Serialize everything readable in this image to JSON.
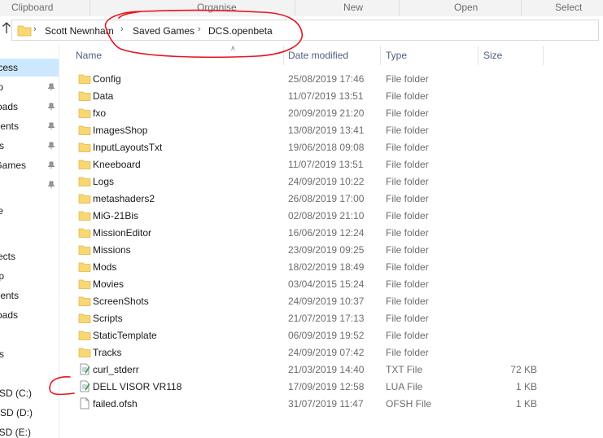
{
  "ribbon": {
    "groups": [
      "Clipboard",
      "Organise",
      "New",
      "Open",
      "Select"
    ]
  },
  "address": {
    "crumbs": [
      "Scott Newnham",
      "Saved Games",
      "DCS.openbeta"
    ]
  },
  "nav": {
    "items": [
      {
        "label": "cess",
        "pinned": false,
        "selected": true
      },
      {
        "label": "p",
        "pinned": true
      },
      {
        "label": "oads",
        "pinned": true
      },
      {
        "label": "ents",
        "pinned": true
      },
      {
        "label": "s",
        "pinned": true
      },
      {
        "label": "Games",
        "pinned": true
      },
      {
        "label": "",
        "pinned": true
      },
      {
        "label": "e",
        "pinned": false
      },
      {
        "label": "ects",
        "pinned": false
      },
      {
        "label": "p",
        "pinned": false
      },
      {
        "label": "ents",
        "pinned": false
      },
      {
        "label": "oads",
        "pinned": false
      },
      {
        "label": "s",
        "pinned": false
      },
      {
        "label": "SSD (C:)",
        "pinned": false
      },
      {
        "label": "SSD (D:)",
        "pinned": false
      },
      {
        "label": "SSD (E:)",
        "pinned": false
      }
    ]
  },
  "columns": {
    "name": "Name",
    "date": "Date modified",
    "type": "Type",
    "size": "Size"
  },
  "files": [
    {
      "name": "Config",
      "date": "25/08/2019 17:46",
      "type": "File folder",
      "size": "",
      "icon": "folder-icon"
    },
    {
      "name": "Data",
      "date": "11/07/2019 13:51",
      "type": "File folder",
      "size": "",
      "icon": "folder-icon"
    },
    {
      "name": "fxo",
      "date": "20/09/2019 21:20",
      "type": "File folder",
      "size": "",
      "icon": "folder-icon"
    },
    {
      "name": "ImagesShop",
      "date": "13/08/2019 13:41",
      "type": "File folder",
      "size": "",
      "icon": "folder-icon"
    },
    {
      "name": "InputLayoutsTxt",
      "date": "19/06/2018 09:08",
      "type": "File folder",
      "size": "",
      "icon": "folder-icon"
    },
    {
      "name": "Kneeboard",
      "date": "11/07/2019 13:51",
      "type": "File folder",
      "size": "",
      "icon": "folder-icon"
    },
    {
      "name": "Logs",
      "date": "24/09/2019 10:22",
      "type": "File folder",
      "size": "",
      "icon": "folder-icon"
    },
    {
      "name": "metashaders2",
      "date": "26/08/2019 17:00",
      "type": "File folder",
      "size": "",
      "icon": "folder-icon"
    },
    {
      "name": "MiG-21Bis",
      "date": "02/08/2019 21:10",
      "type": "File folder",
      "size": "",
      "icon": "folder-icon"
    },
    {
      "name": "MissionEditor",
      "date": "16/06/2019 12:24",
      "type": "File folder",
      "size": "",
      "icon": "folder-icon"
    },
    {
      "name": "Missions",
      "date": "23/09/2019 09:25",
      "type": "File folder",
      "size": "",
      "icon": "folder-icon"
    },
    {
      "name": "Mods",
      "date": "18/02/2019 18:49",
      "type": "File folder",
      "size": "",
      "icon": "folder-icon"
    },
    {
      "name": "Movies",
      "date": "03/04/2015 15:24",
      "type": "File folder",
      "size": "",
      "icon": "folder-icon"
    },
    {
      "name": "ScreenShots",
      "date": "24/09/2019 10:37",
      "type": "File folder",
      "size": "",
      "icon": "folder-icon"
    },
    {
      "name": "Scripts",
      "date": "21/07/2019 17:13",
      "type": "File folder",
      "size": "",
      "icon": "folder-icon"
    },
    {
      "name": "StaticTemplate",
      "date": "06/09/2019 19:52",
      "type": "File folder",
      "size": "",
      "icon": "folder-icon"
    },
    {
      "name": "Tracks",
      "date": "24/09/2019 07:42",
      "type": "File folder",
      "size": "",
      "icon": "folder-icon"
    },
    {
      "name": "curl_stderr",
      "date": "21/03/2019 14:40",
      "type": "TXT File",
      "size": "72 KB",
      "icon": "text-file-icon"
    },
    {
      "name": "DELL VISOR VR118",
      "date": "17/09/2019 12:58",
      "type": "LUA File",
      "size": "1 KB",
      "icon": "text-file-icon"
    },
    {
      "name": "failed.ofsh",
      "date": "31/07/2019 11:47",
      "type": "OFSH File",
      "size": "1 KB",
      "icon": "blank-file-icon"
    }
  ],
  "colors": {
    "folder": "#f8d775",
    "folder_dark": "#e6b13a",
    "selection": "#cce8ff",
    "header_text": "#4d6082",
    "annotation": "#e8141e"
  }
}
